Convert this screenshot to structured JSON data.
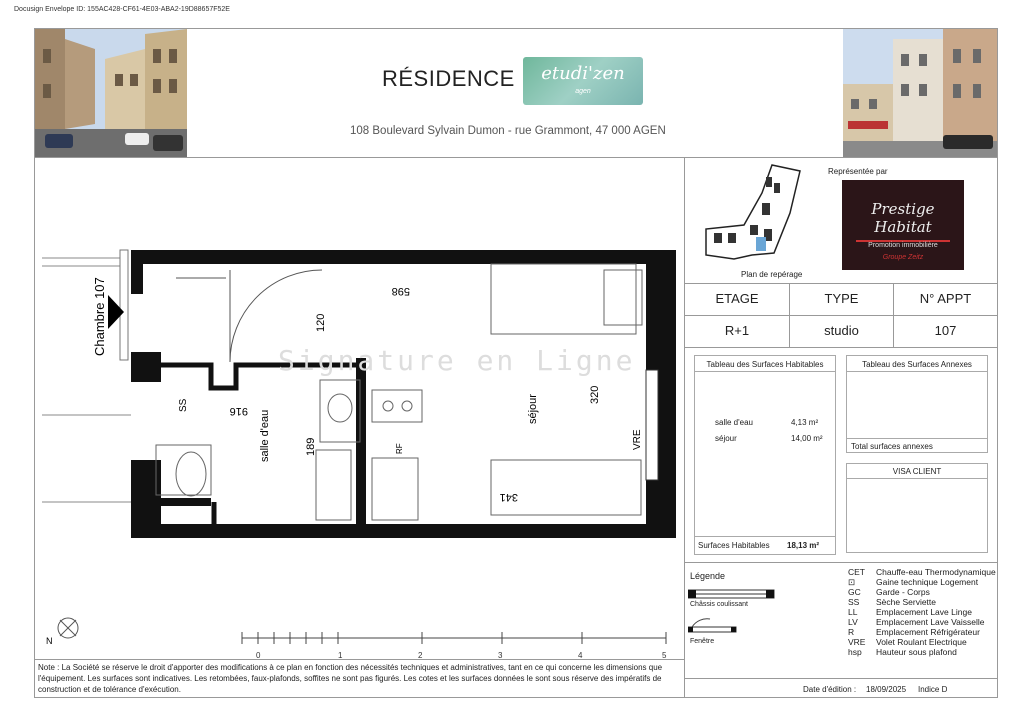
{
  "docusign_id": "Docusign Envelope ID: 155AC428-CF61-4E03-ABA2-19D88657F52E",
  "header": {
    "title": "RÉSIDENCE",
    "logo_main": "etudi'zen",
    "logo_sub": "agen",
    "address": "108 Boulevard Sylvain Dumon - rue Grammont, 47 000 AGEN"
  },
  "plan": {
    "watermark": "Signature en Ligne",
    "room_label": "Chambre 107",
    "dim_598": "598",
    "dim_120": "120",
    "dim_916": "916",
    "dim_189": "189",
    "dim_320": "320",
    "dim_341": "341",
    "salle_deau": "salle d'eau",
    "sejour": "séjour",
    "ss": "SS",
    "rf": "RF",
    "vre": "VRE",
    "north": "N",
    "scale_ticks": [
      "0",
      "1",
      "2",
      "3",
      "4",
      "5"
    ]
  },
  "reperage": {
    "caption": "Plan de repérage",
    "represented_by": "Représentée par",
    "brand_line1": "Prestige",
    "brand_line2": "Habitat",
    "brand_tagline": "Promotion immobilière",
    "brand_group": "Groupe Zeitz"
  },
  "info": {
    "headers": [
      "ETAGE",
      "TYPE",
      "N° APPT"
    ],
    "values": [
      "R+1",
      "studio",
      "107"
    ]
  },
  "surfaces": {
    "title": "Tableau des Surfaces Habitables",
    "rows": [
      {
        "label": "salle d'eau",
        "value": "4,13 m²"
      },
      {
        "label": "séjour",
        "value": "14,00 m²"
      }
    ],
    "total_label": "Surfaces Habitables",
    "total_value": "18,13 m²"
  },
  "annexes": {
    "title": "Tableau des Surfaces Annexes",
    "total_label": "Total surfaces annexes"
  },
  "visa": {
    "title": "VISA CLIENT"
  },
  "legend": {
    "title": "Légende",
    "chassis": "Châssis coulissant",
    "fenetre": "Fenêtre",
    "codes": [
      {
        "code": "CET",
        "label": "Chauffe-eau Thermodynamique"
      },
      {
        "code": "⊡",
        "label": "Gaine technique Logement"
      },
      {
        "code": "GC",
        "label": "Garde - Corps"
      },
      {
        "code": "SS",
        "label": "Sèche Serviette"
      },
      {
        "code": "LL",
        "label": "Emplacement Lave Linge"
      },
      {
        "code": "LV",
        "label": "Emplacement Lave Vaisselle"
      },
      {
        "code": "R",
        "label": "Emplacement Réfrigérateur"
      },
      {
        "code": "VRE",
        "label": "Volet Roulant Electrique"
      },
      {
        "code": "hsp",
        "label": "Hauteur sous plafond"
      }
    ]
  },
  "footer": {
    "note": "Note : La Société se réserve le droit d'apporter des modifications à ce plan en fonction des nécessités techniques et administratives, tant en ce qui concerne les dimensions que l'équipement. Les surfaces sont indicatives. Les retombées, faux-plafonds, soffites ne sont pas figurés. Les cotes et les surfaces données le sont sous réserve des impératifs de construction et de tolérance d'exécution.",
    "date_label": "Date d'édition :",
    "date_value": "18/09/2025",
    "index": "Indice D"
  }
}
